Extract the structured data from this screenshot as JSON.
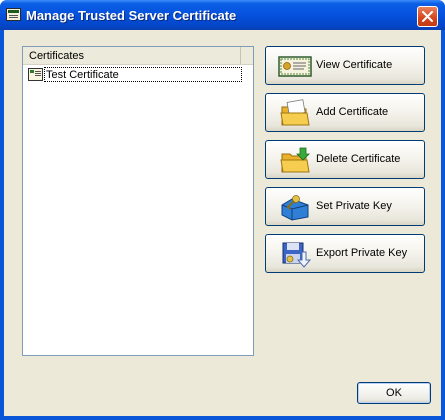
{
  "window": {
    "title": "Manage Trusted Server Certificate",
    "title_icon": "certificate-icon",
    "close_icon": "close-icon"
  },
  "list": {
    "column_header": "Certificates",
    "items": [
      {
        "label": "Test Certificate",
        "icon": "certificate-icon"
      }
    ]
  },
  "buttons": {
    "view": {
      "label": "View Certificate",
      "icon": "certificate-icon"
    },
    "add": {
      "label": "Add Certificate",
      "icon": "folder-add-icon"
    },
    "delete": {
      "label": "Delete Certificate",
      "icon": "folder-delete-icon"
    },
    "set_key": {
      "label": "Set Private Key",
      "icon": "key-box-icon"
    },
    "export_key": {
      "label": "Export Private Key",
      "icon": "export-key-icon"
    },
    "ok": {
      "label": "OK"
    }
  },
  "colors": {
    "titlebar": "#0551dd",
    "dialog_bg": "#ece9d8",
    "button_border": "#003c74"
  }
}
